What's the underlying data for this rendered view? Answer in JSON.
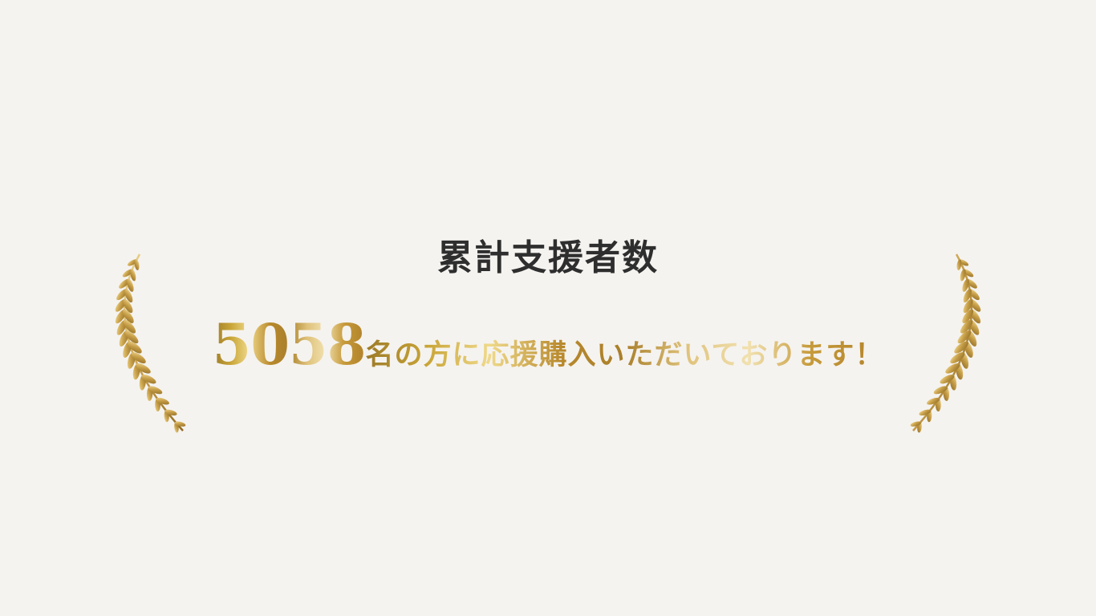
{
  "heading": "累計支援者数",
  "count": "5058",
  "message": "名の方に応援購入いただいております！",
  "colors": {
    "background": "#f5f3f0",
    "heading": "#2e2e2e",
    "gold_dark": "#a97f2b",
    "gold_light": "#efd98a"
  },
  "decorations": {
    "left_icon": "laurel-branch-icon",
    "right_icon": "laurel-branch-icon"
  }
}
